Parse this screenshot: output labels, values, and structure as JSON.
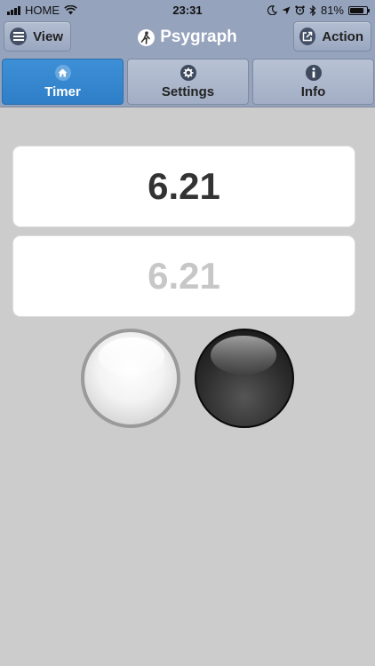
{
  "status_bar": {
    "carrier": "HOME",
    "time": "23:31",
    "battery": "81%",
    "battery_level": 0.81
  },
  "header": {
    "title": "Psygraph",
    "view_label": "View",
    "action_label": "Action"
  },
  "tabs": [
    {
      "label": "Timer",
      "icon": "home-icon",
      "active": true
    },
    {
      "label": "Settings",
      "icon": "gear-icon",
      "active": false
    },
    {
      "label": "Info",
      "icon": "info-icon",
      "active": false
    }
  ],
  "timer": {
    "value": "6.21",
    "echo_value": "6.21"
  },
  "colors": {
    "header_bg": "#95a3bd",
    "active_tab": "#3688d0",
    "page_bg": "#cccccc"
  }
}
